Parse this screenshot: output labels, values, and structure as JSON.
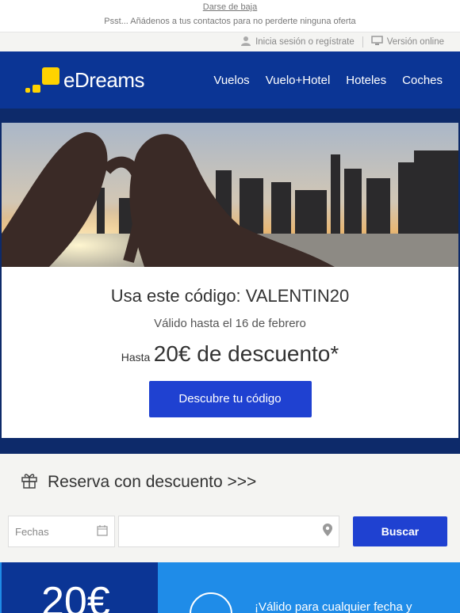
{
  "preheader": {
    "unsubscribe": "Darse de baja",
    "psst": "Psst... Añádenos a tus contactos para no perderte ninguna oferta"
  },
  "account_bar": {
    "login": "Inicia sesión o regístrate",
    "online": "Versión online"
  },
  "header": {
    "brand": "eDreams",
    "nav": [
      "Vuelos",
      "Vuelo+Hotel",
      "Hoteles",
      "Coches"
    ]
  },
  "promo": {
    "title": "Usa este código: VALENTIN20",
    "valid": "Válido hasta el 16 de febrero",
    "upto": "Hasta",
    "discount": "20€ de descuento*",
    "cta": "Descubre tu código"
  },
  "booking": {
    "title": "Reserva con descuento >>>",
    "date_placeholder": "Fechas",
    "search_button": "Buscar"
  },
  "bottom_banner": {
    "amount": "20€",
    "text": "¡Válido para cualquier fecha y"
  },
  "colors": {
    "brand_blue": "#0b3595",
    "cta_blue": "#1f41d1",
    "logo_yellow": "#ffd300",
    "banner_blue": "#1f8ce8"
  }
}
